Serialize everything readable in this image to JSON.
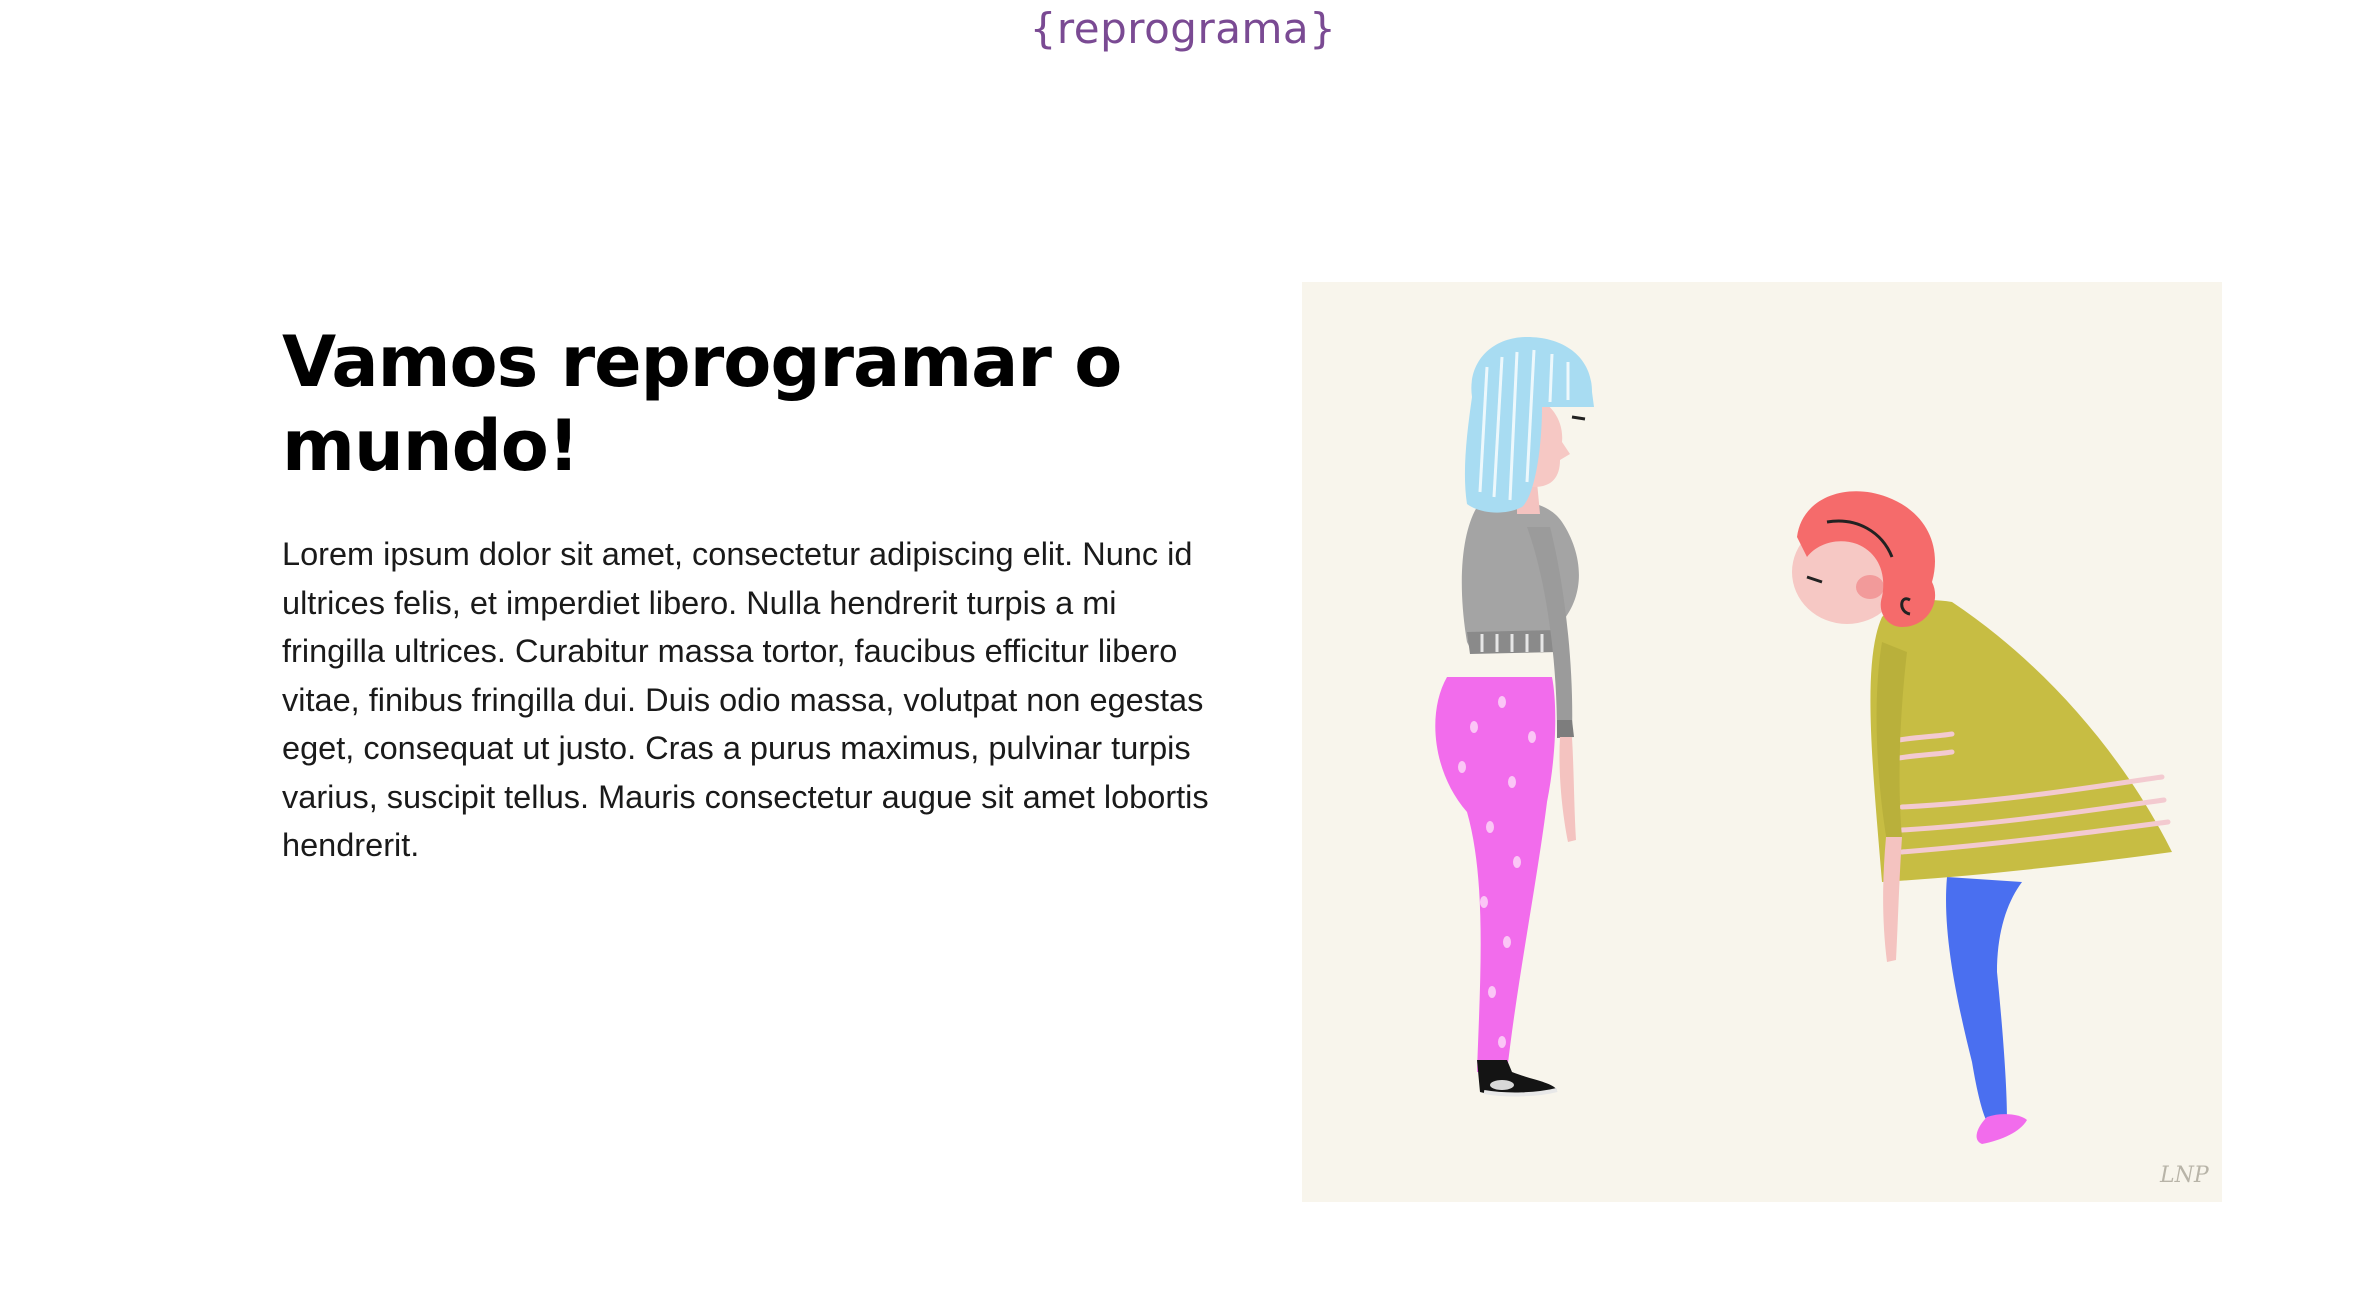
{
  "header": {
    "logo_text": "{reprograma}"
  },
  "hero": {
    "heading": "Vamos reprogramar o mundo!",
    "body": "Lorem ipsum dolor sit amet, consectetur adipiscing elit. Nunc id ultrices felis, et imperdiet libero. Nulla hendrerit turpis a mi fringilla ultrices. Curabitur massa tortor, faucibus efficitur libero vitae, finibus fringilla dui. Duis odio massa, volutpat non egestas eget, consequat ut justo. Cras a purus maximus, pulvinar turpis varius, suscipit tellus. Mauris consectetur augue sit amet lobortis hendrerit.",
    "illustration": {
      "signature": "LNP"
    }
  },
  "colors": {
    "brand_purple": "#7a4a93",
    "illustration_background": "#f8f5ec",
    "heading_text": "#000000",
    "body_text": "#1a1a1a"
  }
}
